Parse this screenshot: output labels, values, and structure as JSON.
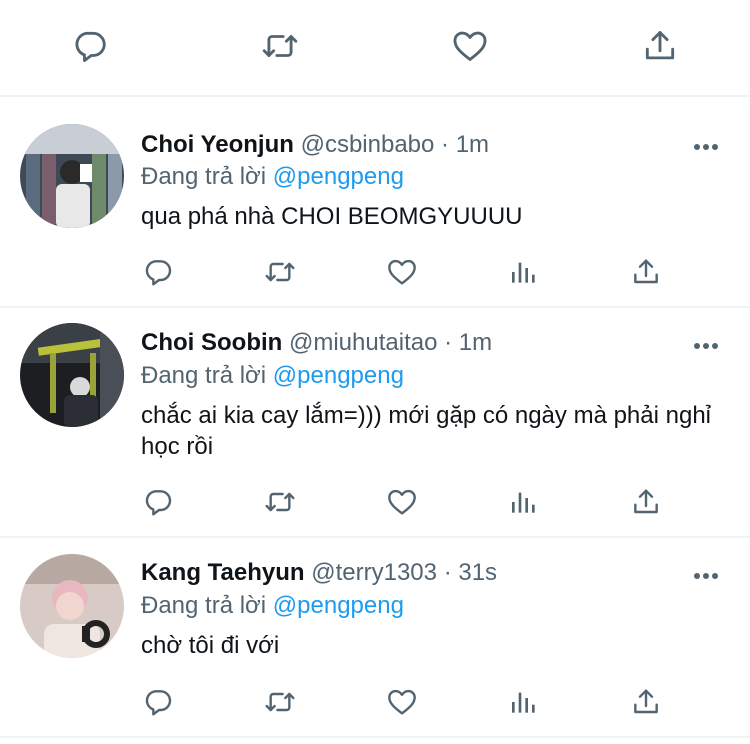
{
  "colors": {
    "text": "#0f1419",
    "muted": "#536471",
    "link": "#1d9bf0",
    "divider": "#eff3f4"
  },
  "top_actions": [
    "reply-icon",
    "retweet-icon",
    "like-icon",
    "share-icon"
  ],
  "tweets": [
    {
      "name": "Choi Yeonjun",
      "handle": "@csbinbabo",
      "dot": "·",
      "time": "1m",
      "reply_prefix": "Đang trả lời",
      "reply_to": "@pengpeng",
      "text": "qua phá nhà CHOI BEOMGYUUUU"
    },
    {
      "name": "Choi Soobin",
      "handle": "@miuhutaitao",
      "dot": "·",
      "time": "1m",
      "reply_prefix": "Đang trả lời",
      "reply_to": "@pengpeng",
      "text": "chắc ai kia cay lắm=))) mới gặp có ngày mà phải nghỉ học rồi"
    },
    {
      "name": "Kang Taehyun",
      "handle": "@terry1303",
      "dot": "·",
      "time": "31s",
      "reply_prefix": "Đang trả lời",
      "reply_to": "@pengpeng",
      "text": "chờ tôi đi với"
    }
  ]
}
